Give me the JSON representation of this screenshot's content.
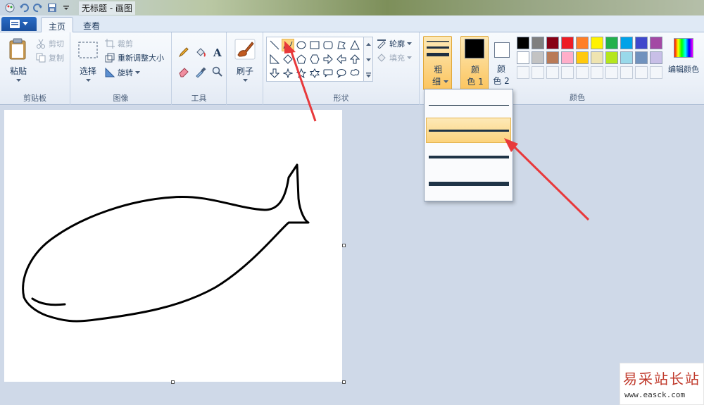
{
  "window": {
    "title": "无标题 - 画图"
  },
  "tabs": [
    {
      "label": "主页",
      "active": true
    },
    {
      "label": "查看",
      "active": false
    }
  ],
  "clipboard": {
    "paste_label": "粘贴",
    "cut_label": "剪切",
    "copy_label": "复制",
    "group_label": "剪贴板"
  },
  "image": {
    "select_label": "选择",
    "crop_label": "裁剪",
    "resize_label": "重新调整大小",
    "rotate_label": "旋转",
    "group_label": "图像"
  },
  "tools": {
    "group_label": "工具"
  },
  "brushes": {
    "label": "刷子"
  },
  "shapes": {
    "group_label": "形状",
    "outline_label": "轮廓",
    "fill_label": "填充",
    "selected_shape": "curve"
  },
  "size": {
    "label_top": "粗",
    "label_bottom": "细"
  },
  "colors": {
    "color1_top": "颜",
    "color1_bottom": "色 1",
    "color2_top": "颜",
    "color2_bottom": "色 2",
    "color1_value": "#000000",
    "color2_value": "#ffffff",
    "edit_label": "编辑颜色",
    "group_label": "颜色",
    "palette_row1": [
      "#000000",
      "#7f7f7f",
      "#880015",
      "#ed1c24",
      "#ff7f27",
      "#fff200",
      "#22b14c",
      "#00a2e8",
      "#3f48cc",
      "#a349a4"
    ],
    "palette_row2": [
      "#ffffff",
      "#c3c3c3",
      "#b97a57",
      "#ffaec9",
      "#ffc90e",
      "#efe4b0",
      "#b5e61d",
      "#99d9ea",
      "#7092be",
      "#c8bfe7"
    ]
  },
  "size_dropdown": {
    "options_count": 4,
    "selected_index": 1
  },
  "watermark": {
    "main": "易采站长站",
    "sub": "www.easck.com"
  }
}
